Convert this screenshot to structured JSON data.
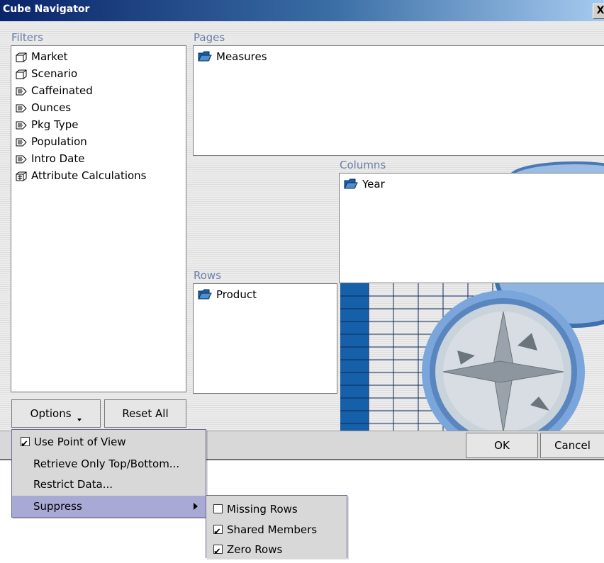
{
  "window": {
    "title": "Cube Navigator",
    "close_glyph": "X"
  },
  "filters": {
    "label": "Filters",
    "items": [
      {
        "label": "Market",
        "icon": "cube-icon"
      },
      {
        "label": "Scenario",
        "icon": "cube-icon"
      },
      {
        "label": "Caffeinated",
        "icon": "attribute-icon"
      },
      {
        "label": "Ounces",
        "icon": "attribute-icon"
      },
      {
        "label": "Pkg Type",
        "icon": "attribute-icon"
      },
      {
        "label": "Population",
        "icon": "attribute-icon"
      },
      {
        "label": "Intro Date",
        "icon": "attribute-icon"
      },
      {
        "label": "Attribute Calculations",
        "icon": "calculation-cube-icon"
      }
    ]
  },
  "pages": {
    "label": "Pages",
    "items": [
      {
        "label": "Measures",
        "icon": "dimension-folder-icon"
      }
    ]
  },
  "columns": {
    "label": "Columns",
    "items": [
      {
        "label": "Year",
        "icon": "dimension-folder-icon"
      }
    ]
  },
  "rows": {
    "label": "Rows",
    "items": [
      {
        "label": "Product",
        "icon": "dimension-folder-icon"
      }
    ]
  },
  "buttons": {
    "options": "Options",
    "reset_all": "Reset All",
    "ok": "OK",
    "cancel": "Cancel"
  },
  "options_menu": {
    "items": [
      {
        "label": "Use Point of View",
        "checked": true
      },
      {
        "label": "Retrieve Only Top/Bottom..."
      },
      {
        "label": "Restrict Data..."
      },
      {
        "label": "Suppress",
        "submenu": true,
        "highlighted": true
      }
    ]
  },
  "suppress_menu": {
    "items": [
      {
        "label": "Missing Rows",
        "checked": false
      },
      {
        "label": "Shared Members",
        "checked": true
      },
      {
        "label": "Zero Rows",
        "checked": true
      }
    ]
  },
  "colors": {
    "accent": "#0a246a",
    "menu_highlight": "#a9a9d6",
    "grid_blue": "#1560a8"
  }
}
